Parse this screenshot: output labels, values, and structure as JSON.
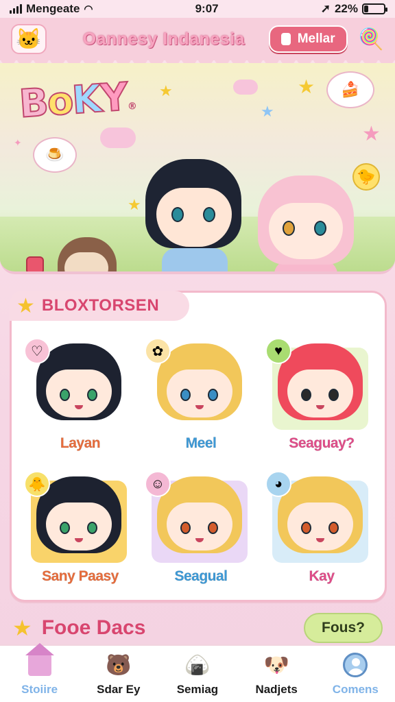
{
  "status_bar": {
    "carrier": "Mengeate",
    "time": "9:07",
    "battery_text": "22%",
    "battery_level": 0.22
  },
  "header": {
    "title": "Oannesy Indanesia",
    "action_label": "Mellar",
    "logo_icon": "cat-logo-icon",
    "right_icon": "candy-icon"
  },
  "hero": {
    "title_letters": [
      "B",
      "o",
      "K",
      "Y"
    ],
    "title_suffix": "®"
  },
  "characters": {
    "section_title": "BLOXTORSEN",
    "items": [
      {
        "name": "Layan",
        "name_color": "#e96d3c",
        "hair": "#1d2230",
        "bg": "#ffffff",
        "eye": "#3aa36a",
        "badge_icon": "heart-icon",
        "badge_color": "#f8c2d6"
      },
      {
        "name": "Meel",
        "name_color": "#3d9ad8",
        "hair": "#f2c75a",
        "bg": "#ffffff",
        "eye": "#3a8ec4",
        "badge_icon": "flower-icon",
        "badge_color": "#fbe3a6"
      },
      {
        "name": "Seaguay?",
        "name_color": "#e24d8a",
        "hair": "#ef4a5c",
        "bg": "#e9f5cf",
        "eye": "#2a2a2a",
        "badge_icon": "heart-green-icon",
        "badge_color": "#a9dc71"
      },
      {
        "name": "Sany Paasy",
        "name_color": "#e96d3c",
        "hair": "#1d2230",
        "bg": "#f9d36a",
        "eye": "#3aa36a",
        "badge_icon": "chick-icon",
        "badge_color": "#f7e06a"
      },
      {
        "name": "Seagual",
        "name_color": "#3d9ad8",
        "hair": "#f2c75a",
        "bg": "#ead8f6",
        "eye": "#d35c2c",
        "badge_icon": "smile-icon",
        "badge_color": "#f4b8d4"
      },
      {
        "name": "Kay",
        "name_color": "#e24d8a",
        "hair": "#f2c75a",
        "bg": "#d8ecf8",
        "eye": "#d35c2c",
        "badge_icon": "seal-icon",
        "badge_color": "#a8d4ef"
      }
    ]
  },
  "section2": {
    "title": "Fooe Dacs",
    "button_label": "Fous?"
  },
  "bottom_nav": [
    {
      "label": "Stoiire",
      "icon": "home-icon"
    },
    {
      "label": "Sdar Ey",
      "icon": "cat-icon"
    },
    {
      "label": "Semiag",
      "icon": "rice-ball-icon"
    },
    {
      "label": "Nadjets",
      "icon": "dog-icon"
    },
    {
      "label": "Comens",
      "icon": "profile-icon"
    }
  ]
}
